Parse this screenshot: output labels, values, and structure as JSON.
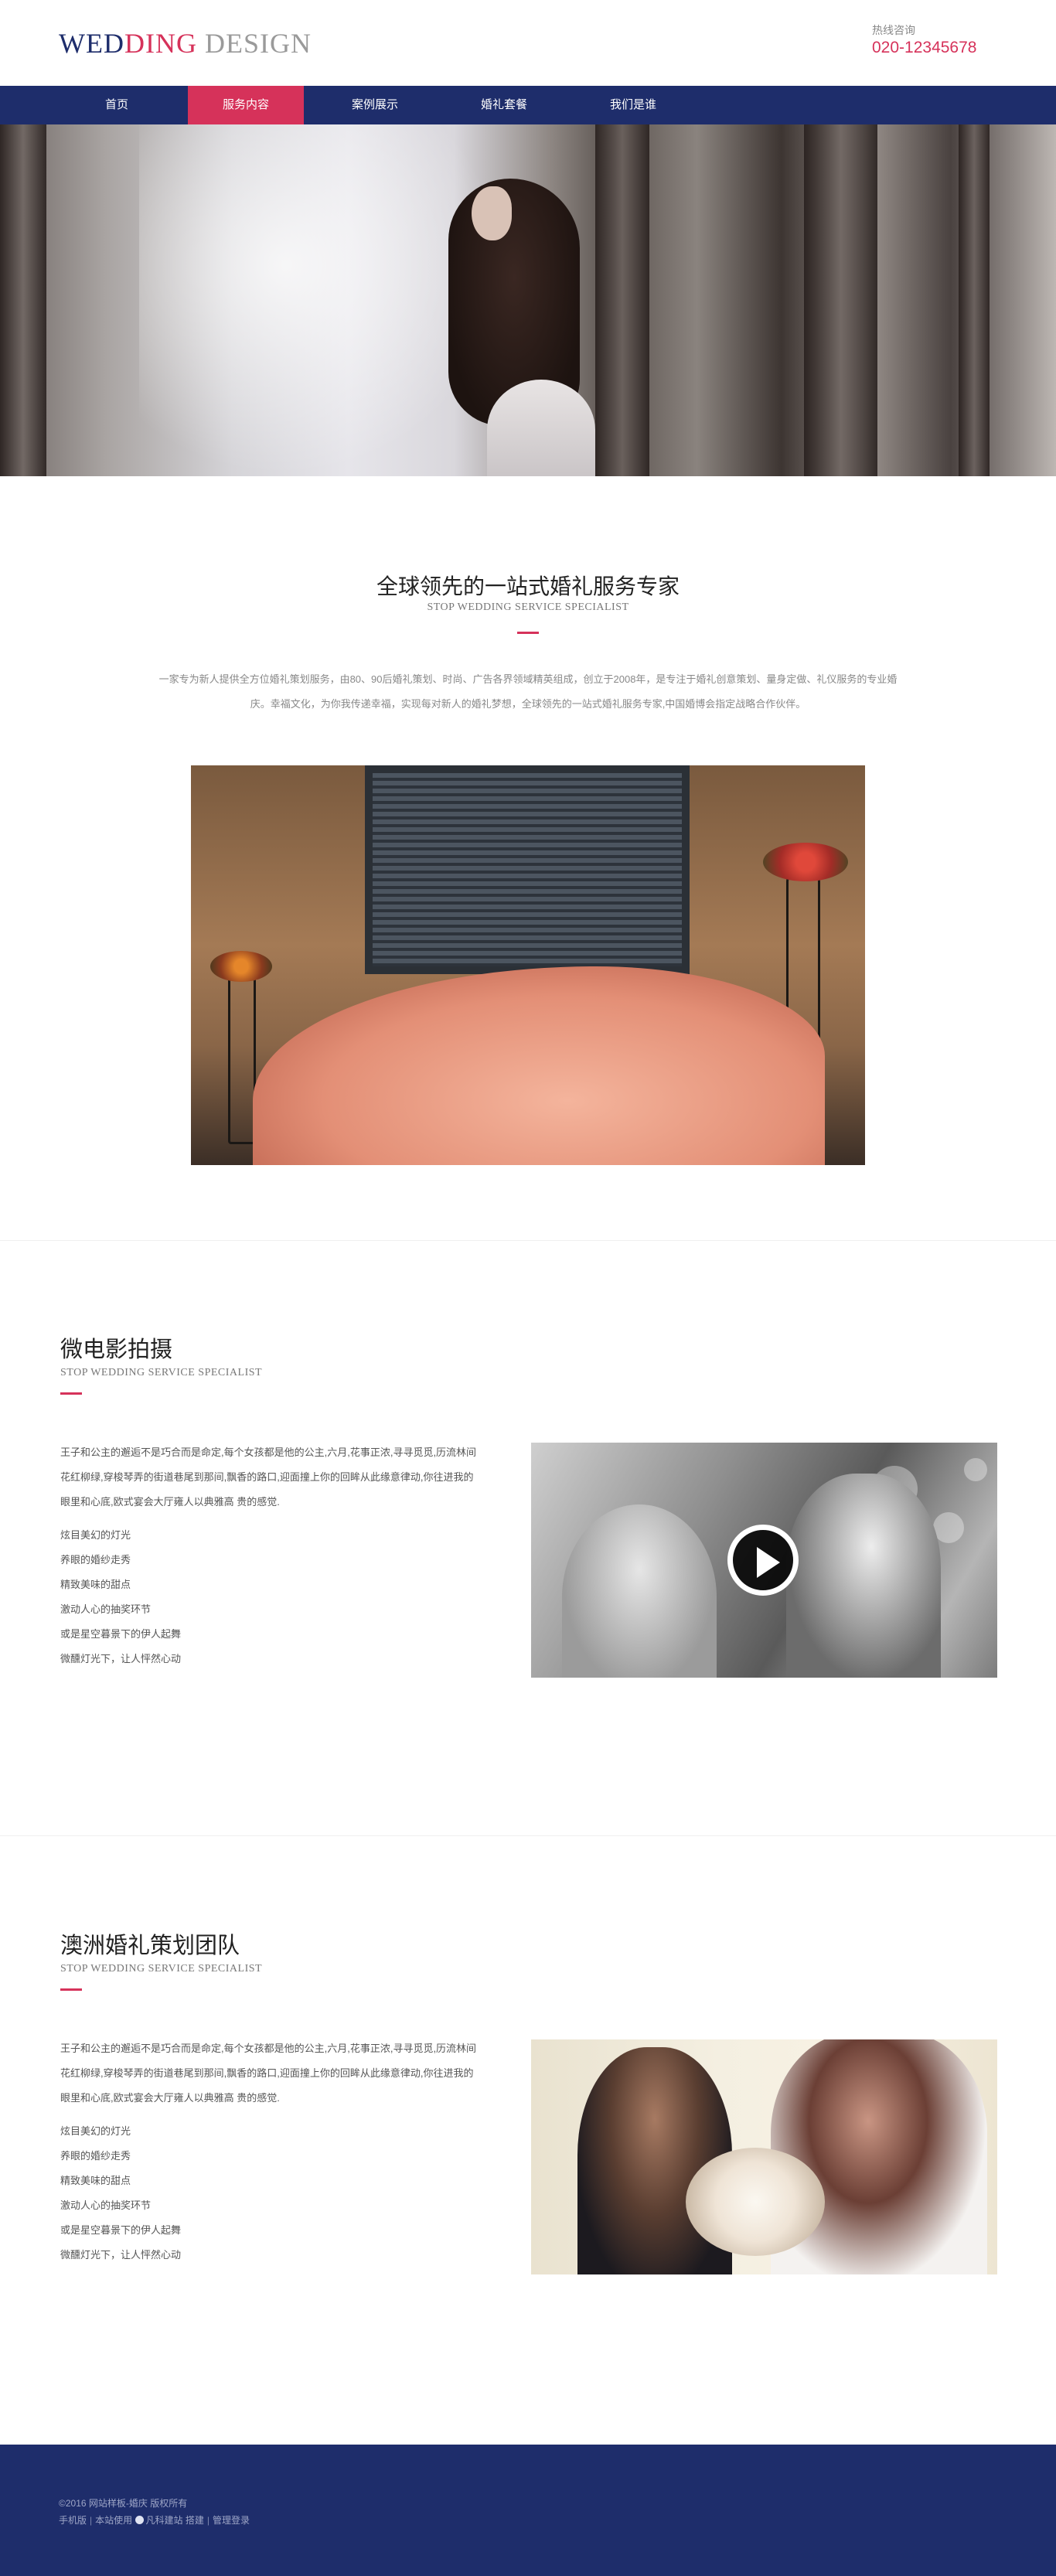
{
  "header": {
    "logo": {
      "part1": "WED",
      "part2": "DING",
      "part3": "DESIGN"
    },
    "hotline_label": "热线咨询",
    "hotline_number": "020-12345678"
  },
  "nav": {
    "items": [
      {
        "label": "首页",
        "active": false
      },
      {
        "label": "服务内容",
        "active": true
      },
      {
        "label": "案例展示",
        "active": false
      },
      {
        "label": "婚礼套餐",
        "active": false
      },
      {
        "label": "我们是谁",
        "active": false
      }
    ]
  },
  "intro": {
    "title": "全球领先的一站式婚礼服务专家",
    "subtitle": "STOP WEDDING SERVICE SPECIALIST",
    "text_line1": "一家专为新人提供全方位婚礼策划服务，由80、90后婚礼策划、时尚、广告各界领域精英组成，创立于2008年，是专注于婚礼创意策划、量身定做、礼仪服务的专业婚",
    "text_line2": "庆。幸福文化，为你我传递幸福，实现每对新人的婚礼梦想，全球领先的一站式婚礼服务专家,中国婚博会指定战略合作伙伴。"
  },
  "section_film": {
    "title": "微电影拍摄",
    "subtitle": "STOP WEDDING SERVICE SPECIALIST",
    "paragraph": "王子和公主的邂逅不是巧合而是命定,每个女孩都是他的公主,六月,花事正浓,寻寻觅觅,历流林间花红柳绿,穿梭琴弄的街道巷尾到那间,飘香的路口,迎面撞上你的回眸从此缘意律动,你往进我的眼里和心底,欧式宴会大厅雍人以典雅高 贵的感觉.",
    "list": [
      "炫目美幻的灯光",
      "养眼的婚纱走秀",
      "精致美味的甜点",
      "激动人心的抽奖环节",
      "或是星空暮景下的伊人起舞",
      "微醺灯光下，让人怦然心动"
    ]
  },
  "section_team": {
    "title": "澳洲婚礼策划团队",
    "subtitle": "STOP WEDDING SERVICE SPECIALIST",
    "paragraph": "王子和公主的邂逅不是巧合而是命定,每个女孩都是他的公主,六月,花事正浓,寻寻觅觅,历流林间花红柳绿,穿梭琴弄的街道巷尾到那间,飘香的路口,迎面撞上你的回眸从此缘意律动,你往进我的眼里和心底,欧式宴会大厅雍人以典雅高 贵的感觉.",
    "list": [
      "炫目美幻的灯光",
      "养眼的婚纱走秀",
      "精致美味的甜点",
      "激动人心的抽奖环节",
      "或是星空暮景下的伊人起舞",
      "微醺灯光下，让人怦然心动"
    ]
  },
  "footer": {
    "copyright": "©2016 网站样板-婚庆 版权所有",
    "mobile_label": "手机版",
    "powered_prefix": "本站使用",
    "powered_brand": "凡科建站",
    "build_label": "搭建",
    "admin_label": "管理登录",
    "separator": "|"
  },
  "colors": {
    "brand_navy": "#1e2d6b",
    "accent_pink": "#d6325a"
  }
}
